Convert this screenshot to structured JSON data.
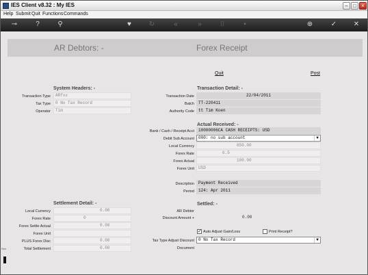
{
  "window": {
    "title": "IES Client v8.32 : My IES"
  },
  "menu": [
    "Help",
    "Submit",
    "Quit",
    "Functions",
    "Commands"
  ],
  "toolbar": {
    "icons": [
      "key-icon",
      "help-icon",
      "search-icon",
      "heart-icon",
      "refresh-icon",
      "rewind-icon",
      "fast-forward-icon",
      "pin-icon",
      "copy-icon",
      "add-icon",
      "check-icon",
      "close-icon"
    ]
  },
  "header": {
    "left_title": "AR Debtors: -",
    "right_title": "Forex Receipt",
    "quit": "Quit",
    "post": "Post"
  },
  "system_headers": {
    "title": "System Headers: -",
    "transaction_type_label": "Transaction Type",
    "transaction_type": "ARfxx",
    "tax_type_label": "Tax Type",
    "tax_type": "0 No Tax Record",
    "operator_label": "Operator",
    "operator": "Tim"
  },
  "transaction_detail": {
    "title": "Transaction Detail: -",
    "date_label": "Transaction Date",
    "date": "22/04/2011",
    "batch_label": "Batch",
    "batch": "TT-220411",
    "authority_label": "Authority Code",
    "authority": "tt Tim Koen"
  },
  "actual_received": {
    "title": "Actual Received: -",
    "bank_label": "Bank / Cash / Receipt Acct",
    "bank": "10000006CA CASH RECEIPTS: USD",
    "debit_sub_label": "Debit Sub Account",
    "debit_sub": "000: no sub account",
    "local_currency_label": "Local Currency",
    "local_currency": "650.00",
    "forex_rate_label": "Forex Rate",
    "forex_rate": "6.5",
    "forex_actual_label": "Forex Actual",
    "forex_actual": "100.00",
    "forex_unit_label": "Forex Unit",
    "forex_unit": "USD",
    "description_label": "Description",
    "description": "Payment Received",
    "period_label": "Period",
    "period": "124: Apr 2011"
  },
  "settlement_detail": {
    "title": "Settlement Detail: -",
    "local_currency_label": "Local Currency",
    "local_currency": "0.00",
    "forex_rate_label": "Forex Rate",
    "forex_rate": "0",
    "forex_settle_label": "Forex Settle Actual",
    "forex_settle": "0.00",
    "forex_unit_label": "Forex Unit",
    "forex_unit": "",
    "plus_forex_disc_label": "PLUS Forex Disc",
    "plus_forex_disc": "0.00",
    "total_settlement_label": "Total Settlement",
    "total_settlement": "0.00"
  },
  "settled": {
    "title": "Settled: -",
    "ar_debtor_label": "AR Debtor",
    "ar_debtor": "",
    "discount_label": "Discount Amount +",
    "discount": "0.00",
    "auto_adjust_label": "Auto Adjust Gain/Loss",
    "auto_adjust_checked": true,
    "print_receipt_label": "Print Receipt?",
    "print_receipt_checked": false,
    "tax_adjust_label": "Tax Type Adjust Discount",
    "tax_adjust": "0 No Tax Record",
    "document_label": "Document",
    "document": ""
  },
  "sidebar": {
    "label": "Ses"
  }
}
